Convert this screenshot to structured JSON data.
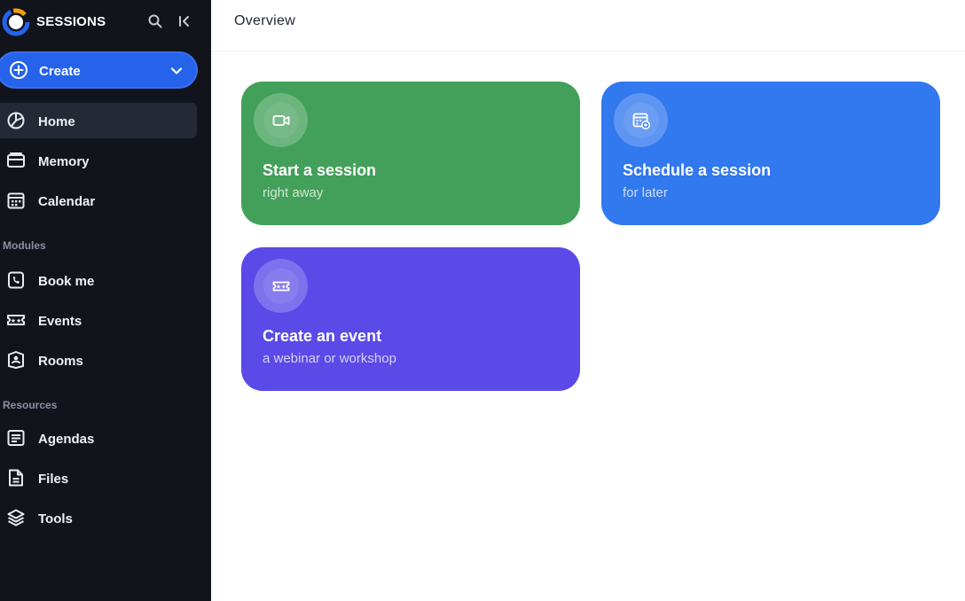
{
  "app": {
    "name": "SESSIONS"
  },
  "sidebar": {
    "create_label": "Create",
    "nav": [
      {
        "label": "Home",
        "icon": "home-icon",
        "active": true
      },
      {
        "label": "Memory",
        "icon": "memory-icon"
      },
      {
        "label": "Calendar",
        "icon": "calendar-icon"
      }
    ],
    "modules_label": "Modules",
    "modules": [
      {
        "label": "Book me",
        "icon": "book-me-icon"
      },
      {
        "label": "Events",
        "icon": "ticket-icon"
      },
      {
        "label": "Rooms",
        "icon": "rooms-icon"
      }
    ],
    "resources_label": "Resources",
    "resources": [
      {
        "label": "Agendas",
        "icon": "agenda-icon"
      },
      {
        "label": "Files",
        "icon": "files-icon"
      },
      {
        "label": "Tools",
        "icon": "layers-icon"
      }
    ]
  },
  "main": {
    "title": "Overview",
    "cards": [
      {
        "title": "Start a session",
        "subtitle": "right away",
        "icon": "video-camera-icon",
        "color": "#43a05a"
      },
      {
        "title": "Schedule a session",
        "subtitle": "for later",
        "icon": "calendar-add-icon",
        "color": "#3278ef"
      },
      {
        "title": "Create an event",
        "subtitle": "a webinar or workshop",
        "icon": "ticket-icon",
        "color": "#5b49e8"
      }
    ]
  },
  "colors": {
    "sidebar_bg": "#12141c",
    "accent": "#2563eb",
    "active_item": "#252935"
  }
}
